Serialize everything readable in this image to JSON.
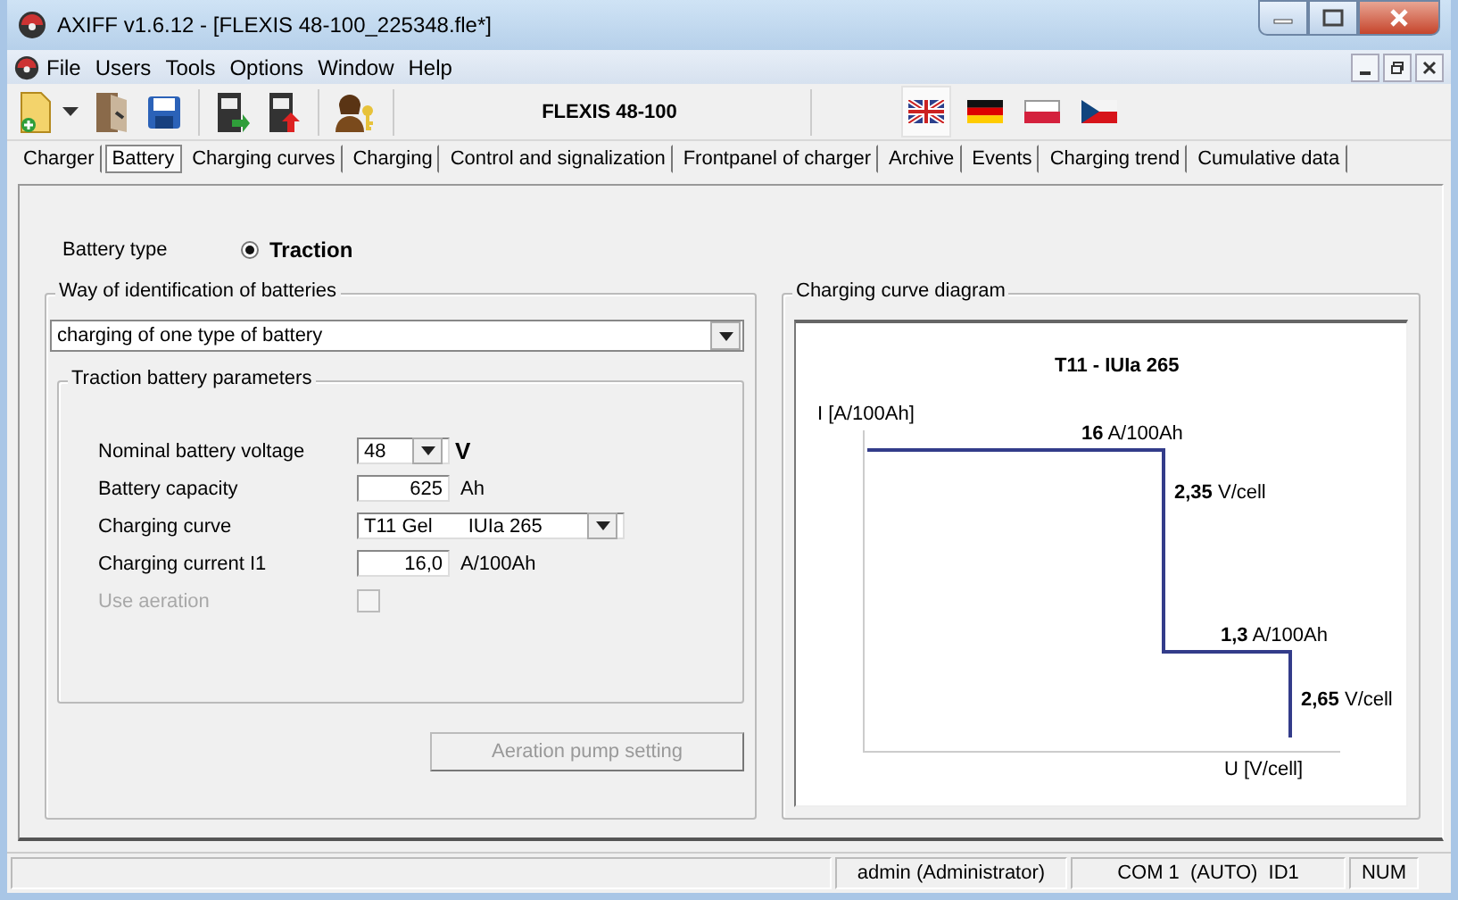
{
  "window": {
    "title": "AXIFF v1.6.12 - [FLEXIS 48-100_225348.fle*]"
  },
  "menu": [
    "File",
    "Users",
    "Tools",
    "Options",
    "Window",
    "Help"
  ],
  "toolbar": {
    "device": "FLEXIS 48-100",
    "languages": [
      {
        "kind": "uk",
        "selected": true
      },
      {
        "kind": "de",
        "selected": false
      },
      {
        "kind": "pl",
        "selected": false
      },
      {
        "kind": "cz",
        "selected": false
      }
    ]
  },
  "tabs": [
    {
      "label": "Charger",
      "selected": false
    },
    {
      "label": "Battery",
      "selected": true
    },
    {
      "label": "Charging curves",
      "selected": false
    },
    {
      "label": "Charging",
      "selected": false
    },
    {
      "label": "Control and signalization",
      "selected": false
    },
    {
      "label": "Frontpanel of charger",
      "selected": false
    },
    {
      "label": "Archive",
      "selected": false
    },
    {
      "label": "Events",
      "selected": false
    },
    {
      "label": "Charging trend",
      "selected": false
    },
    {
      "label": "Cumulative data",
      "selected": false
    }
  ],
  "battery_type": {
    "label": "Battery type",
    "option": "Traction",
    "selected": true
  },
  "identification": {
    "title": "Way of identification of batteries",
    "value": "charging of one type of battery"
  },
  "parameters": {
    "title": "Traction battery parameters",
    "rows": [
      {
        "kind": "select",
        "label": "Nominal battery voltage",
        "value": "48",
        "unit": "V"
      },
      {
        "kind": "input",
        "label": "Battery capacity",
        "value": "625",
        "unit": "Ah"
      },
      {
        "kind": "select",
        "label": "Charging curve",
        "value": "T11 Gel",
        "detail": "IUIa 265"
      },
      {
        "kind": "input",
        "label": "Charging current I1",
        "value": "16,0",
        "unit": "A/100Ah"
      },
      {
        "kind": "checkbox",
        "label": "Use aeration",
        "checked": false,
        "disabled": true
      }
    ]
  },
  "pump_button": {
    "label": "Aeration pump setting",
    "disabled": true
  },
  "diagram": {
    "title": "Charging curve diagram",
    "curve_title": "T11 - IUIa 265",
    "y_axis": "I [A/100Ah]",
    "x_axis": "U [V/cell]",
    "labels": [
      "**16** A/100Ah",
      "**2,35** V/cell",
      "**1,3** A/100Ah",
      "**2,65** V/cell"
    ]
  },
  "status_bar": [
    "admin (Administrator)",
    "COM 1  (AUTO)  ID1",
    "NUM"
  ]
}
